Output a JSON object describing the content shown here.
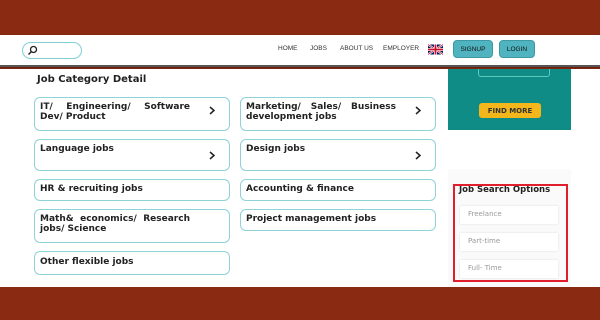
{
  "header": {
    "nav": [
      "HOME",
      "JOBS",
      "ABOUT US",
      "EMPLOYER"
    ],
    "signup_label": "SIGNUP",
    "login_label": "LOGIN"
  },
  "main": {
    "title": "Job Category Detail",
    "categories": [
      "IT/ Engineering/ Software Dev/ Product",
      "Marketing/ Sales/ Business development jobs",
      "Language jobs",
      "Design jobs",
      "HR & recruiting jobs",
      "Accounting & finance",
      "Math& economics/ Research jobs/ Science",
      "Project management jobs",
      "Other flexible jobs"
    ]
  },
  "ad": {
    "button_label": "FIND MORE"
  },
  "job_search": {
    "title": "Job Search Options",
    "options": [
      "Freelance",
      "Part-time",
      "Full- Time"
    ]
  },
  "colors": {
    "band": "#8a2a12",
    "accent": "#4fb4bf",
    "card_border": "#8fd2d8",
    "highlight": "#e01e2c",
    "ad_bg": "#0f8c86",
    "ad_button": "#f4b71b"
  },
  "icons": [
    "search-icon",
    "uk-flag-icon",
    "chevron-right-icon"
  ]
}
